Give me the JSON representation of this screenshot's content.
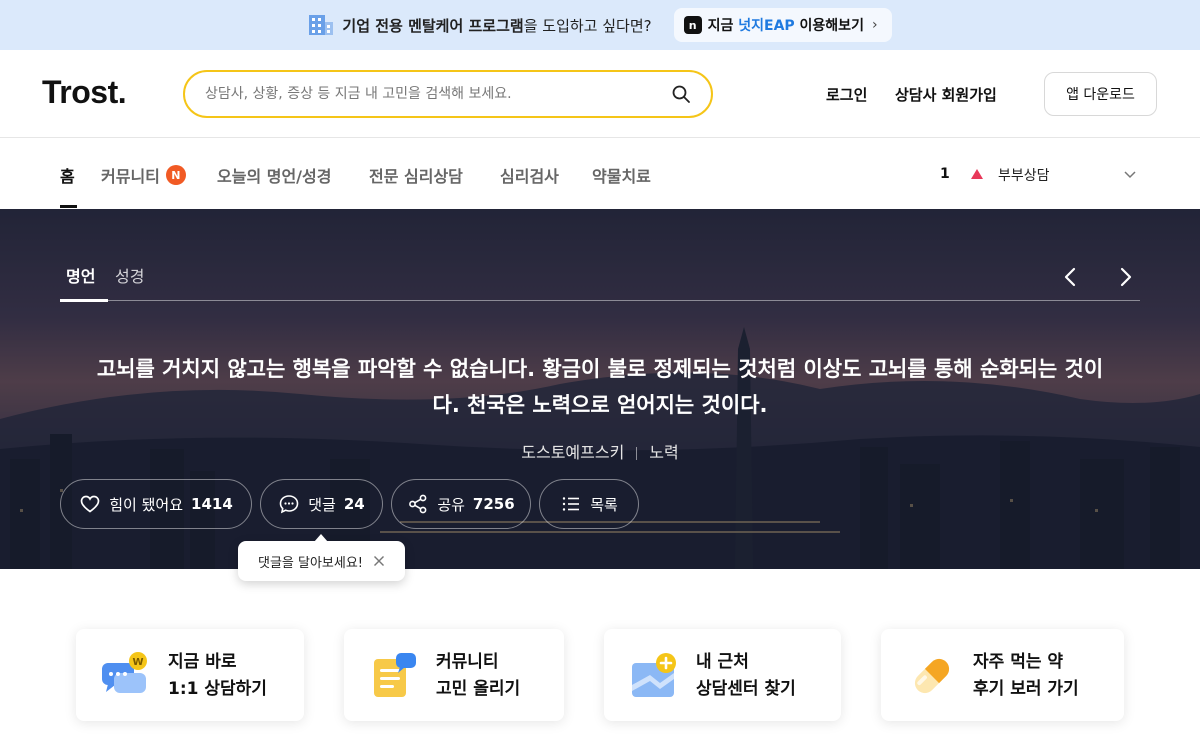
{
  "promo": {
    "text_bold": "기업 전용 멘탈케어 프로그램",
    "text_rest": "을 도입하고 싶다면?",
    "cta_prefix": "지금 ",
    "cta_brand": "넛지EAP",
    "cta_suffix": " 이용해보기",
    "cta_chevron": "›"
  },
  "header": {
    "logo": "Trost.",
    "search_placeholder": "상담사, 상황, 증상 등 지금 내 고민을 검색해 보세요.",
    "login": "로그인",
    "counselor_signup": "상담사 회원가입",
    "app_download": "앱 다운로드"
  },
  "nav": {
    "items": [
      {
        "label": "홈",
        "active": true
      },
      {
        "label": "커뮤니티",
        "badge": "N"
      },
      {
        "label": "오늘의 명언/성경"
      },
      {
        "label": "전문 심리상담"
      },
      {
        "label": "심리검사"
      },
      {
        "label": "약물치료"
      }
    ],
    "trending": {
      "rank": "1",
      "term": "부부상담"
    }
  },
  "hero": {
    "tabs": [
      "명언",
      "성경"
    ],
    "quote": "고뇌를 거치지 않고는 행복을 파악할 수 없습니다. 황금이 불로 정제되는 것처럼 이상도 고뇌를 통해 순화되는 것이다. 천국은 노력으로 얻어지는 것이다.",
    "author": "도스토예프스키",
    "tag": "노력",
    "actions": {
      "like_label": "힘이 됐어요",
      "like_count": "1414",
      "comment_label": "댓글",
      "comment_count": "24",
      "share_label": "공유",
      "share_count": "7256",
      "list_label": "목록"
    }
  },
  "tooltip": {
    "text": "댓글을 달아보세요!"
  },
  "cards": [
    {
      "line1": "지금 바로",
      "line2": "1:1 상담하기"
    },
    {
      "line1": "커뮤니티",
      "line2": "고민 올리기"
    },
    {
      "line1": "내 근처",
      "line2": "상담센터 찾기"
    },
    {
      "line1": "자주 먹는 약",
      "line2": "후기 보러 가기"
    }
  ],
  "colors": {
    "search_border": "#f5c518",
    "badge": "#f15a24",
    "rank_up": "#e8395a",
    "promo_bg": "#dbe9fb",
    "brand_blue": "#1f7ae0"
  }
}
